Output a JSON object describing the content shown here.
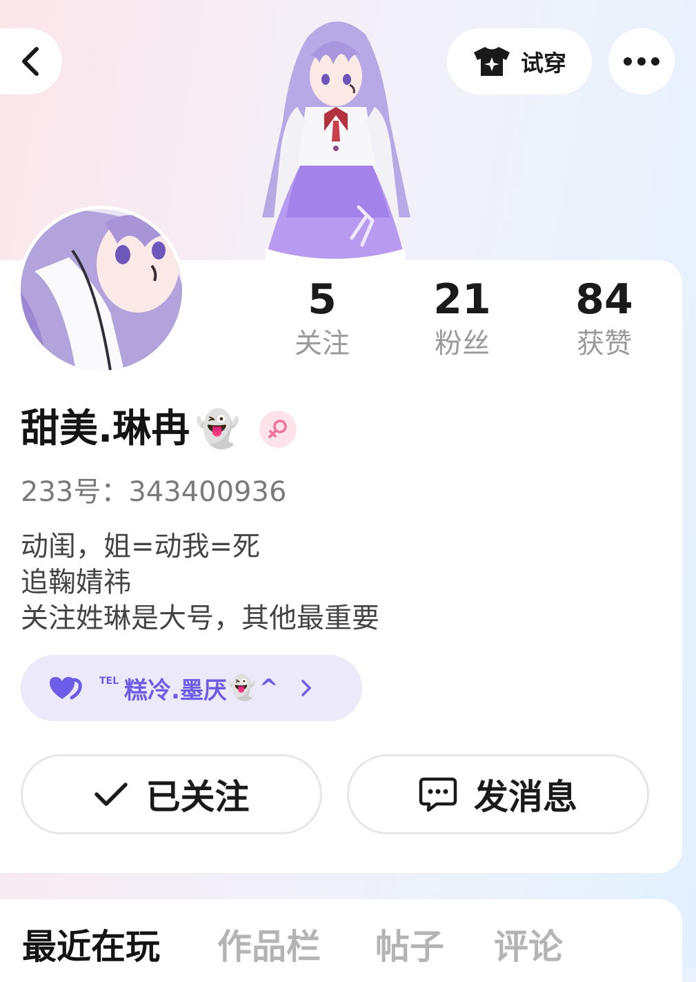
{
  "header": {
    "tryon_label": "试穿"
  },
  "stats": [
    {
      "value": "5",
      "label": "关注"
    },
    {
      "value": "21",
      "label": "粉丝"
    },
    {
      "value": "84",
      "label": "获赞"
    }
  ],
  "profile": {
    "username": "甜美.琳冉",
    "username_emoji": "👻",
    "account_id": "233号：343400936",
    "bio_lines": [
      "动闺，姐=动我=死",
      "追鞠婧祎",
      "关注姓琳是大号，其他最重要"
    ]
  },
  "relation": {
    "prefix": "TEL",
    "name": "糕冷.墨厌",
    "emoji": "👻",
    "suffix": "^",
    "accent": "#6c5ce7"
  },
  "actions": {
    "follow_label": "已关注",
    "message_label": "发消息"
  },
  "tabs": [
    {
      "label": "最近在玩",
      "active": true
    },
    {
      "label": "作品栏",
      "active": false
    },
    {
      "label": "帖子",
      "active": false
    },
    {
      "label": "评论",
      "active": false
    }
  ],
  "icons": {
    "back": "chevron-left-icon",
    "tryon": "tshirt-icon",
    "more": "more-dots-icon",
    "gender": "female-icon",
    "relation": "hearts-icon",
    "follow": "checkmark-icon",
    "message": "chat-bubble-icon"
  }
}
